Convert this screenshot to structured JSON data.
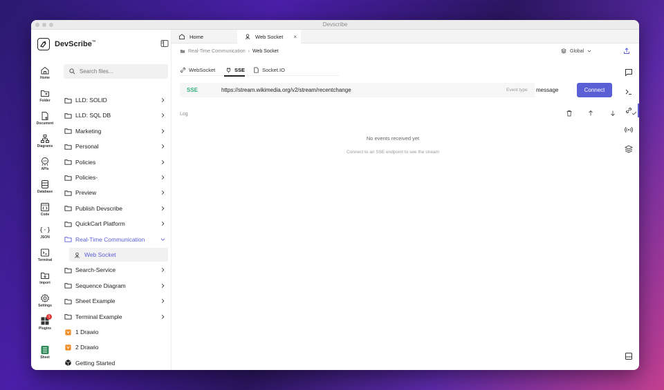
{
  "window": {
    "title": "Devscribe"
  },
  "brand": {
    "name": "DevScribe",
    "mark": "™"
  },
  "rail": [
    {
      "label": "Home",
      "icon": "home-icon"
    },
    {
      "label": "Folder",
      "icon": "folder-icon"
    },
    {
      "label": "Document",
      "icon": "document-icon"
    },
    {
      "label": "Diagrams",
      "icon": "diagram-icon"
    },
    {
      "label": "APIs",
      "icon": "api-icon"
    },
    {
      "label": "Database",
      "icon": "database-icon"
    },
    {
      "label": "Code",
      "icon": "code-icon"
    },
    {
      "label": "JSON",
      "icon": "json-icon"
    },
    {
      "label": "Terminal",
      "icon": "terminal-icon"
    },
    {
      "label": "Import",
      "icon": "import-icon"
    },
    {
      "label": "Settings",
      "icon": "gear-icon"
    },
    {
      "label": "Plugins",
      "icon": "plugins-icon",
      "badge": "1"
    },
    {
      "label": "Sheet",
      "icon": "sheet-icon"
    }
  ],
  "search": {
    "placeholder": "Search files..."
  },
  "tree": [
    {
      "label": "LLD: SOLID",
      "type": "folder"
    },
    {
      "label": "LLD: SQL DB",
      "type": "folder"
    },
    {
      "label": "Marketing",
      "type": "folder"
    },
    {
      "label": "Personal",
      "type": "folder"
    },
    {
      "label": "Policies",
      "type": "folder"
    },
    {
      "label": "Policies-",
      "type": "folder"
    },
    {
      "label": "Preview",
      "type": "folder"
    },
    {
      "label": "Publish Devscribe",
      "type": "folder"
    },
    {
      "label": "QuickCart Platform",
      "type": "folder"
    },
    {
      "label": "Real-Time Communication",
      "type": "folder-open"
    },
    {
      "label": "Web Socket",
      "type": "socket"
    },
    {
      "label": "Search-Service",
      "type": "folder"
    },
    {
      "label": "Sequence Diagram",
      "type": "folder"
    },
    {
      "label": "Sheet Example",
      "type": "folder"
    },
    {
      "label": "Terminal Example",
      "type": "folder"
    },
    {
      "label": "1 Drawio",
      "type": "drawio"
    },
    {
      "label": "2 Drawio",
      "type": "drawio"
    },
    {
      "label": "Getting Started",
      "type": "cube"
    }
  ],
  "tabs": [
    {
      "label": "Home"
    },
    {
      "label": "Web Socket",
      "close": "×"
    }
  ],
  "breadcrumb": {
    "parent": "Real-Time Communication",
    "separator": "›",
    "current": "Web Socket"
  },
  "environment": {
    "label": "Global"
  },
  "protocol_tabs": [
    {
      "label": "WebSocket"
    },
    {
      "label": "SSE"
    },
    {
      "label": "Socket.IO"
    }
  ],
  "request": {
    "protocol": "SSE",
    "url": "https://stream.wikimedia.org/v2/stream/recentchange",
    "event_type_label": "Event type",
    "event_type_value": "message",
    "connect_label": "Connect"
  },
  "log": {
    "label": "Log",
    "empty_title": "No events received yet",
    "empty_hint": "Connect to an SSE endpoint to see the stream"
  },
  "colors": {
    "accent": "#5b5fd6",
    "sse": "#34b07a"
  }
}
